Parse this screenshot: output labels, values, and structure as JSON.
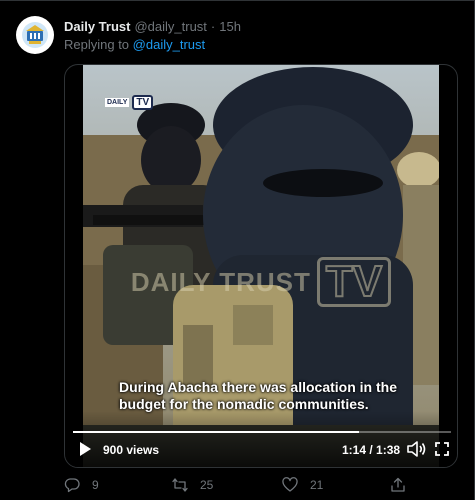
{
  "tweet": {
    "author_name": "Daily Trust",
    "author_handle": "@daily_trust",
    "separator": "·",
    "time": "15h",
    "replying_prefix": "Replying to",
    "replying_to": "@daily_trust"
  },
  "video": {
    "watermark_small": "DAILY",
    "watermark_small_tv": "TV",
    "watermark_big": "DAILY TRUST",
    "watermark_big_tv": "TV",
    "caption": "During Abacha there was allocation in the budget for the nomadic communities.",
    "views": "900 views",
    "timecode": "1:14 / 1:38",
    "progress": 0.757
  },
  "actions": {
    "replies": "9",
    "retweets": "25",
    "likes": "21"
  },
  "icons": {
    "reply": "reply-icon",
    "retweet": "retweet-icon",
    "like": "heart-icon",
    "share": "share-icon",
    "play": "play-icon",
    "volume": "volume-icon",
    "fullscreen": "fullscreen-icon"
  },
  "colors": {
    "background": "#000000",
    "link": "#1d9bf0",
    "muted": "#71767b",
    "text": "#e7e9ea"
  }
}
